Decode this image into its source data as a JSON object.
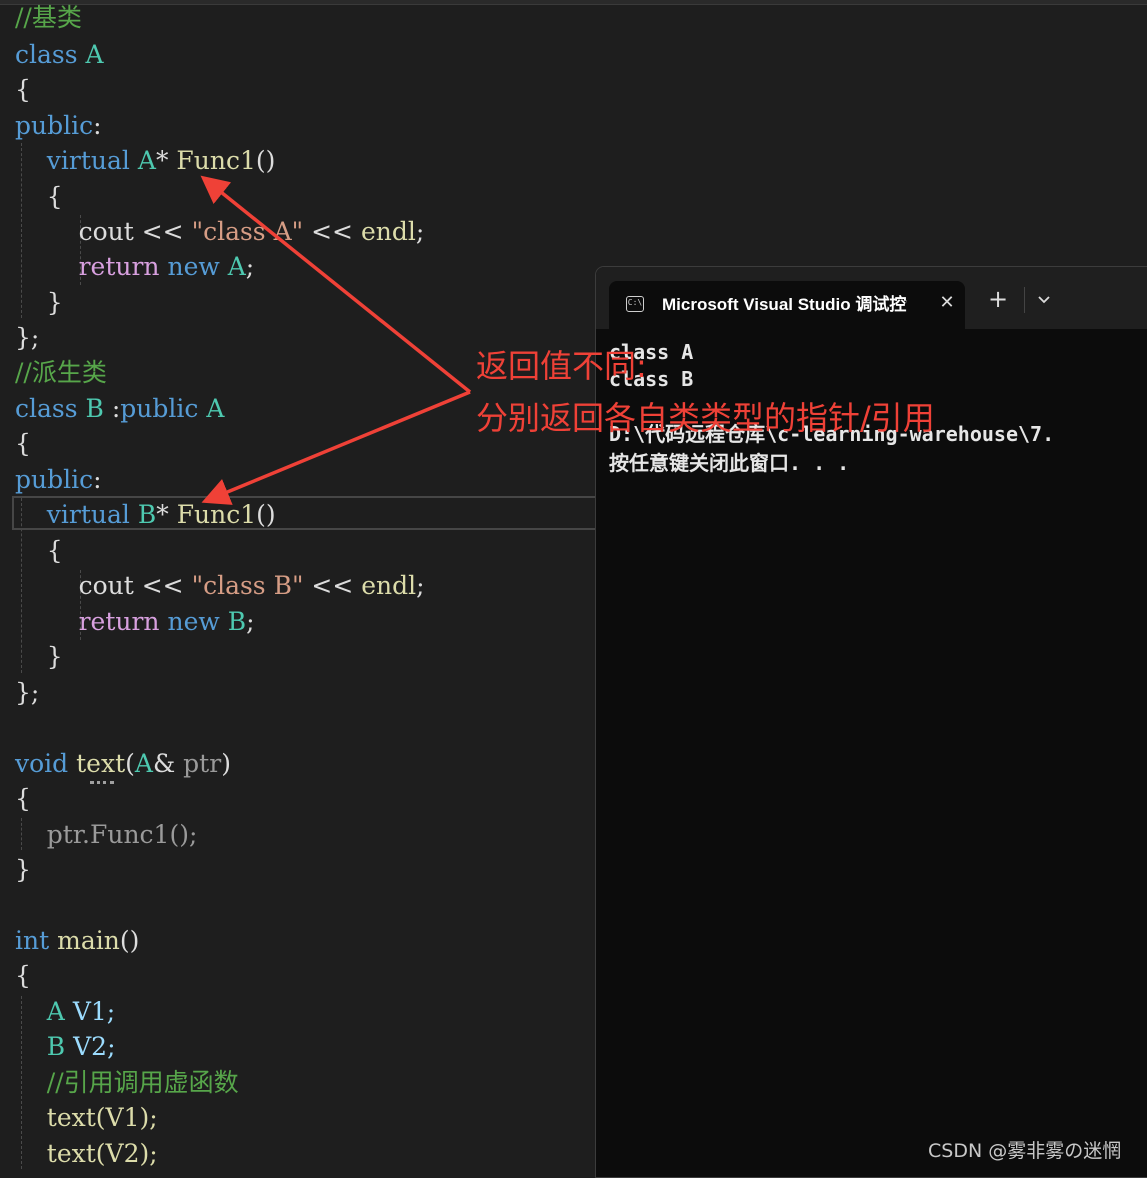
{
  "editor": {
    "code": {
      "l1_comment": "//基类",
      "l2_kw": "class",
      "l2_name": "A",
      "l3": "{",
      "l4_kw": "public",
      "l4_colon": ":",
      "l5_kw": "virtual",
      "l5_type": "A",
      "l5_rest": "* ",
      "l5_fn": "Func1",
      "l5_paren": "()",
      "l6": "{",
      "l7_cout": "cout << ",
      "l7_str": "\"class A\"",
      "l7_op": " << ",
      "l7_endl": "endl",
      "l7_semi": ";",
      "l8_ret": "return",
      "l8_new": "new",
      "l8_type": "A",
      "l8_semi": ";",
      "l9": "}",
      "l10": "};",
      "l11_comment": "//派生类",
      "l12_kw": "class",
      "l12_name": "B",
      "l12_colon": " :",
      "l12_pub": "public",
      "l12_base": "A",
      "l13": "{",
      "l14_kw": "public",
      "l14_colon": ":",
      "l15_kw": "virtual",
      "l15_type": "B",
      "l15_rest": "* ",
      "l15_fn": "Func1",
      "l15_paren": "()",
      "l16": "{",
      "l17_cout": "cout << ",
      "l17_str": "\"class B\"",
      "l17_op": " << ",
      "l17_endl": "endl",
      "l17_semi": ";",
      "l18_ret": "return",
      "l18_new": "new",
      "l18_type": "B",
      "l18_semi": ";",
      "l19": "}",
      "l20": "};",
      "l21_void": "void",
      "l21_fn": "text",
      "l21_open": "(",
      "l21_type": "A",
      "l21_amp": "& ",
      "l21_prm": "ptr",
      "l21_close": ")",
      "l22": "{",
      "l23": "ptr.Func1();",
      "l24": "}",
      "l25_int": "int",
      "l25_fn": "main",
      "l25_paren": "()",
      "l26": "{",
      "l27_type": "A",
      "l27_var": "V1;",
      "l28_type": "B",
      "l28_var": "V2;",
      "l29_comment": "//引用调用虚函数",
      "l30": "text(V1);",
      "l31": "text(V2);"
    }
  },
  "terminal": {
    "tab_title": "Microsoft Visual Studio 调试控制台",
    "close_symbol": "✕",
    "new_tab_symbol": "+",
    "icon_label": "C:\\",
    "output": [
      "class A",
      "class B",
      "",
      "D:\\代码远程仓库\\c-learning-warehouse\\7.",
      "按任意键关闭此窗口. . ."
    ]
  },
  "annotation": {
    "line1": "返回值不同:",
    "line2": "分别返回各自类类型的指针/引用",
    "color": "#ef4137"
  },
  "watermark": "CSDN @雾非雾の迷惘",
  "colors": {
    "keyword": "#569cd6",
    "type": "#4ec9b0",
    "function": "#dcdcaa",
    "string": "#d69d85",
    "comment": "#57a64a",
    "background": "#1e1e1e",
    "terminal_bg": "#0c0c0c"
  }
}
